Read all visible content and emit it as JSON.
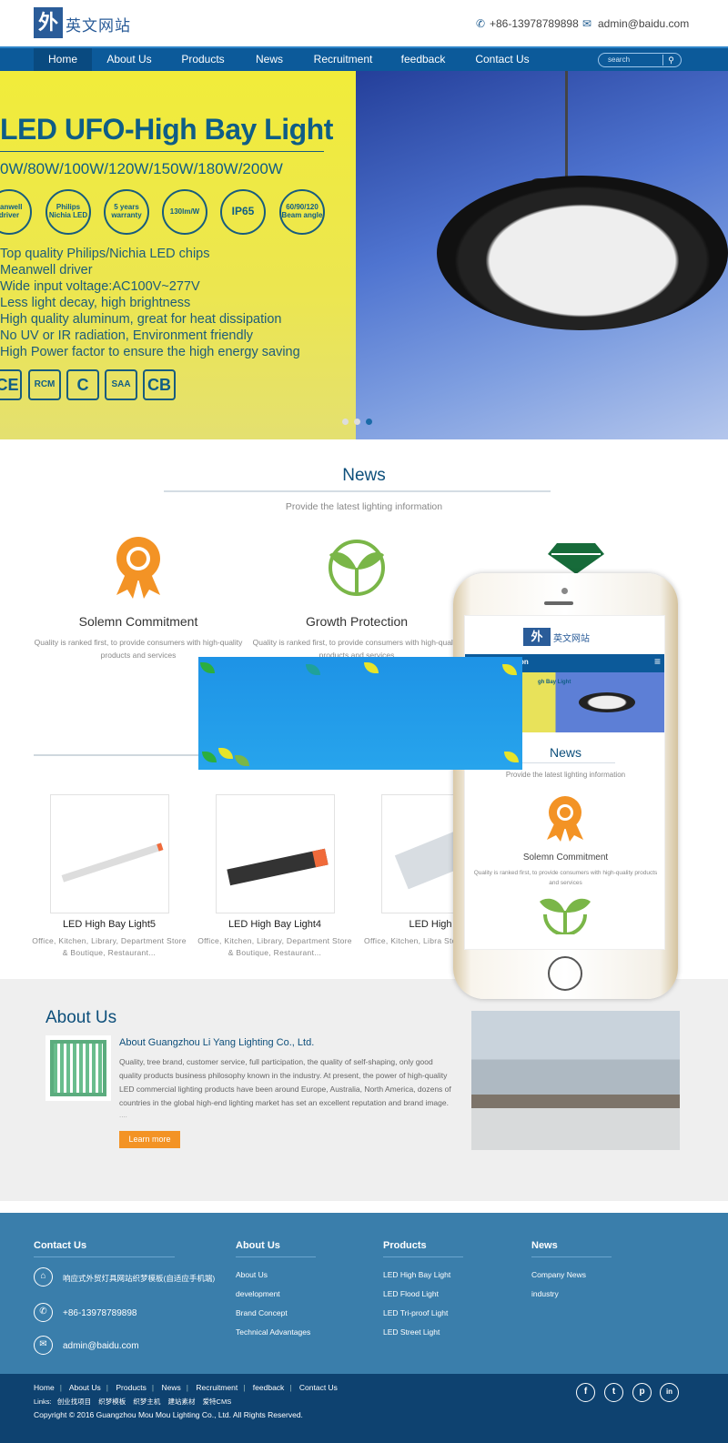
{
  "header": {
    "logo_mark": "外",
    "logo_text": "英文网站",
    "phone": "+86-13978789898",
    "email": "admin@baidu.com"
  },
  "nav": {
    "items": [
      {
        "label": "Home"
      },
      {
        "label": "About Us"
      },
      {
        "label": "Products"
      },
      {
        "label": "News"
      },
      {
        "label": "Recruitment"
      },
      {
        "label": "feedback"
      },
      {
        "label": "Contact Us"
      }
    ],
    "active": "Home",
    "search_placeholder": "search"
  },
  "banner": {
    "title": "LED UFO-High Bay Light",
    "wattage": "0W/80W/100W/120W/150W/180W/200W",
    "badges": [
      "eanwell driver",
      "Philips Nichia LED",
      "5 years warranty",
      "130lm/W",
      "IP65",
      "60/90/120 Beam angle"
    ],
    "features": [
      "Top quality Philips/Nichia LED chips",
      "Meanwell driver",
      "Wide input voltage:AC100V~277V",
      "Less light decay, high brightness",
      "High quality aluminum, great for heat dissipation",
      "No UV or IR radiation, Environment friendly",
      "High Power factor to ensure the high energy saving"
    ],
    "certs": [
      "CE",
      "RCM",
      "C",
      "SAA",
      "CB"
    ],
    "slide_count": 3,
    "active_slide": 3
  },
  "news": {
    "title": "News",
    "subtitle": "Provide the latest lighting information",
    "features": [
      {
        "title": "Solemn Commitment",
        "desc": "Quality is ranked first, to provide consumers with high-quality products and services"
      },
      {
        "title": "Growth Protection",
        "desc": "Quality is ranked first, to provide consumers with high-quality products and services"
      }
    ]
  },
  "products": [
    {
      "title": "LED High Bay Light5",
      "desc": "Office, Kitchen, Library, Department Store & Boutique, Restaurant..."
    },
    {
      "title": "LED High Bay Light4",
      "desc": "Office, Kitchen, Library, Department Store & Boutique, Restaurant..."
    },
    {
      "title": "LED High Bay",
      "desc": "Office, Kitchen, Libra Store & Boutique, F"
    }
  ],
  "phone_mockup": {
    "logo_mark": "外",
    "logo_text": "英文网站",
    "nav_text": "on",
    "banner_text": "gh Bay Light",
    "news_title": "News",
    "news_subtitle": "Provide the latest lighting information",
    "feature_title": "Solemn Commitment",
    "feature_desc": "Quality is ranked first, to provide consumers with high-quality products and services"
  },
  "about": {
    "title": "About Us",
    "company": "About Guangzhou Li Yang Lighting Co., Ltd.",
    "text": "Quality, tree brand, customer service, full participation, the quality of self-shaping, only good quality products business philosophy known in the industry. At present, the power of high-quality LED commercial lighting products have been around Europe, Australia, North America, dozens of countries in the global high-end lighting market has set an excellent reputation and brand image.",
    "ellipsis": "....",
    "button": "Learn more"
  },
  "footer": {
    "contact": {
      "title": "Contact Us",
      "address": "响应式外贸灯具网站织梦模板(自适应手机端)",
      "phone": "+86-13978789898",
      "email": "admin@baidu.com"
    },
    "about": {
      "title": "About Us",
      "links": [
        "About Us",
        "development",
        "Brand Concept",
        "Technical Advantages"
      ]
    },
    "products": {
      "title": "Products",
      "links": [
        "LED High Bay Light",
        "LED Flood Light",
        "LED Tri-proof Light",
        "LED Street Light"
      ]
    },
    "news": {
      "title": "News",
      "links": [
        "Company News",
        "industry"
      ]
    },
    "bottom_nav": [
      "Home",
      "About Us",
      "Products",
      "News",
      "Recruitment",
      "feedback",
      "Contact Us"
    ],
    "links_label": "Links:",
    "links": [
      "创业找项目",
      "织梦模板",
      "织梦主机",
      "建站素材",
      "爱特CMS"
    ],
    "copyright": "Copyright © 2016 Guangzhou Mou Mou Lighting Co., Ltd. All Rights Reserved.",
    "social": [
      "facebook",
      "twitter",
      "pinterest",
      "linkedin"
    ]
  },
  "colors": {
    "nav": "#0c5a9a",
    "footer": "#3a7eab",
    "footer_bottom": "#0e4270",
    "accent_orange": "#f39325",
    "green": "#7ab648"
  }
}
